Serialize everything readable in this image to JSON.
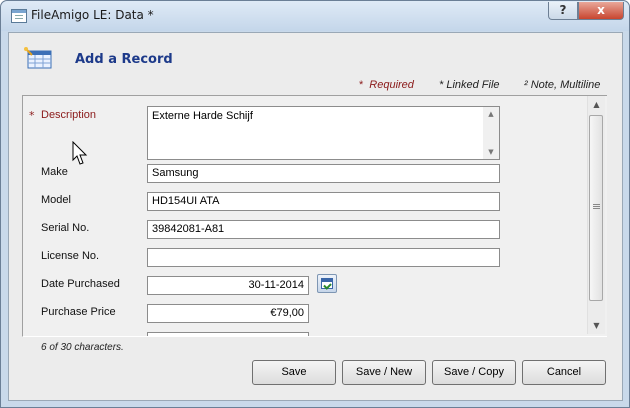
{
  "window": {
    "title": "FileAmigo LE: Data *",
    "help_label": "?",
    "close_label": "x"
  },
  "header": {
    "title": "Add a Record"
  },
  "legend": {
    "required_mark": "*",
    "required_label": "Required",
    "linked_label": "* Linked File",
    "note_label": "² Note, Multiline"
  },
  "form": {
    "description": {
      "label": "Description",
      "marker": "*",
      "value": "Externe Harde Schijf"
    },
    "make": {
      "label": "Make",
      "value": "Samsung"
    },
    "model": {
      "label": "Model",
      "value": "HD154UI ATA"
    },
    "serial": {
      "label": "Serial No.",
      "value": "39842081-A81"
    },
    "license": {
      "label": "License No.",
      "value": ""
    },
    "date_purchased": {
      "label": "Date Purchased",
      "value": "30-11-2014"
    },
    "purchase_price": {
      "label": "Purchase Price",
      "value": "€79,00"
    }
  },
  "status": {
    "char_count": "6 of 30 characters."
  },
  "buttons": {
    "save": "Save",
    "save_new": "Save / New",
    "save_copy": "Save / Copy",
    "cancel": "Cancel"
  },
  "icons": {
    "app": "spreadsheet-icon",
    "header": "add-record-icon",
    "calendar": "calendar-icon",
    "cursor": "mouse-pointer-icon"
  }
}
